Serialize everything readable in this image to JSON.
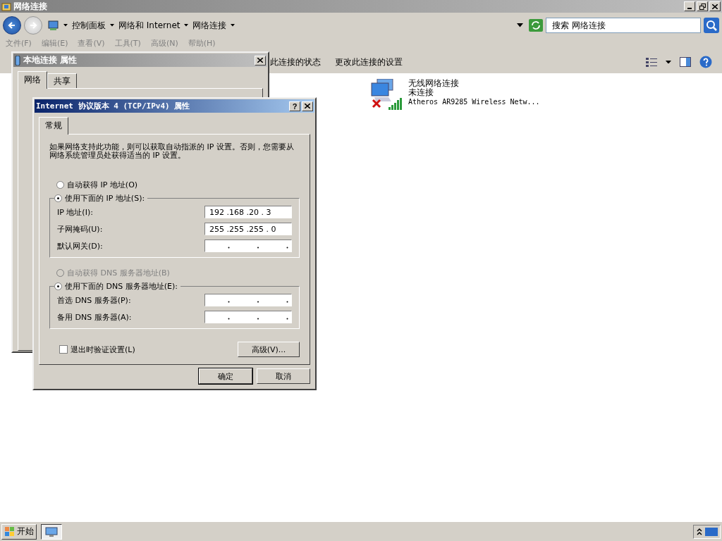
{
  "window": {
    "title": "网络连接"
  },
  "address": {
    "path": [
      "控制面板",
      "网络和 Internet",
      "网络连接"
    ],
    "search_placeholder": "搜索 网络连接"
  },
  "menu": [
    "文件(F)",
    "编辑(E)",
    "查看(V)",
    "工具(T)",
    "高级(N)",
    "帮助(H)"
  ],
  "commands": [
    "此连接的状态",
    "更改此连接的设置"
  ],
  "connections": [
    {
      "name": "无线网络连接",
      "status": "未连接",
      "adapter": "Atheros AR9285 Wireless Netw...",
      "disconnected": true
    }
  ],
  "local_dialog": {
    "title": "本地连接 属性",
    "tabs": [
      {
        "label": "网络",
        "selected": true
      },
      {
        "label": "共享",
        "selected": false
      }
    ]
  },
  "ipv4_dialog": {
    "title": "Internet 协议版本 4 (TCP/IPv4) 属性",
    "help": "?",
    "tabs": [
      {
        "label": "常规",
        "selected": true
      }
    ],
    "description": "如果网络支持此功能，则可以获取自动指派的 IP 设置。否则，您需要从网络系统管理员处获得适当的 IP 设置。",
    "ip_options": [
      {
        "label": "自动获得 IP 地址(O)",
        "selected": false,
        "disabled": false
      },
      {
        "label": "使用下面的 IP 地址(S):",
        "selected": true,
        "disabled": false
      }
    ],
    "ip_fields": [
      {
        "label": "IP 地址(I):",
        "value": "192 .168 .20 . 3"
      },
      {
        "label": "子网掩码(U):",
        "value": "255 .255 .255 . 0"
      },
      {
        "label": "默认网关(D):"
      }
    ],
    "dns_options": [
      {
        "label": "自动获得 DNS 服务器地址(B)",
        "selected": false,
        "disabled": true
      },
      {
        "label": "使用下面的 DNS 服务器地址(E):",
        "selected": true,
        "disabled": false
      }
    ],
    "dns_fields": [
      {
        "label": "首选 DNS 服务器(P):"
      },
      {
        "label": "备用 DNS 服务器(A):"
      }
    ],
    "validate": {
      "label": "退出时验证设置(L)",
      "checked": false
    },
    "advanced": "高级(V)...",
    "buttons": [
      "确定",
      "取消"
    ]
  },
  "taskbar": {
    "start": "开始"
  }
}
